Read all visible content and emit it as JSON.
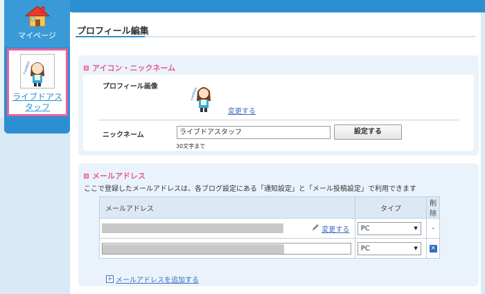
{
  "sidebar": {
    "mypage_label": "マイページ",
    "user_name": "ライブドアスタッフ",
    "house_icon": "house-icon",
    "arrow_color": "#ec5e9c"
  },
  "page": {
    "title": "プロフィール編集"
  },
  "icon_section": {
    "heading": "アイコン・ニックネーム",
    "profile_image_label": "プロフィール画像",
    "change_link": "変更する",
    "nickname_label": "ニックネーム",
    "nickname_value": "ライブドアスタッフ",
    "set_button": "設定する",
    "char_limit": "30文字まで"
  },
  "email_section": {
    "heading": "メールアドレス",
    "description": "ここで登録したメールアドレスは、各ブログ設定にある「通知設定」と「メール投稿設定」で利用できます",
    "columns": {
      "email": "メールアドレス",
      "type": "タイプ",
      "delete": "削除"
    },
    "rows": [
      {
        "change_link": "変更する",
        "type": "PC",
        "delete": "-"
      },
      {
        "type": "PC",
        "delete": "×"
      }
    ],
    "add_link": "メールアドレスを追加する"
  },
  "colors": {
    "accent_blue": "#2d8fd2",
    "accent_pink": "#e45a8e",
    "link": "#3d6cc0"
  }
}
